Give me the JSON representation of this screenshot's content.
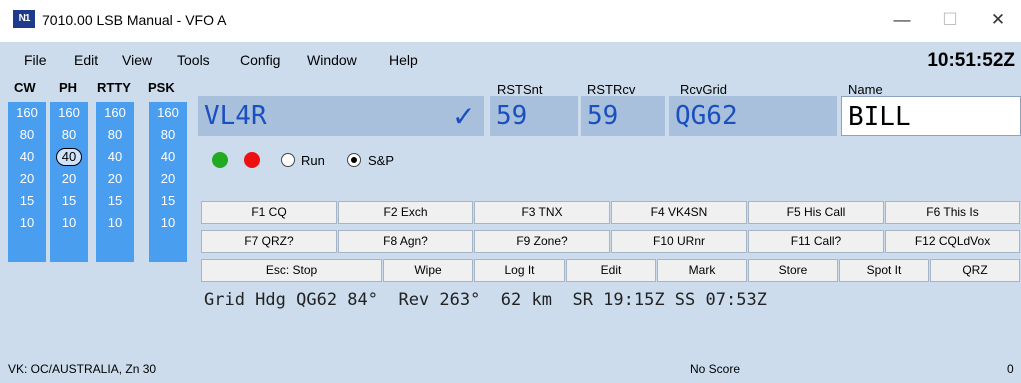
{
  "window": {
    "icon_text": "N1",
    "title": "7010.00 LSB Manual - VFO A",
    "minimize": "—",
    "maximize": "☐",
    "close": "✕"
  },
  "menu": [
    "File",
    "Edit",
    "View",
    "Tools",
    "Config",
    "Window",
    "Help"
  ],
  "clock": "10:51:52Z",
  "band_columns": [
    {
      "mode": "CW",
      "bands": [
        "160",
        "80",
        "40",
        "20",
        "15",
        "10"
      ]
    },
    {
      "mode": "PH",
      "bands": [
        "160",
        "80",
        "40",
        "20",
        "15",
        "10"
      ],
      "selected": "40"
    },
    {
      "mode": "RTTY",
      "bands": [
        "160",
        "80",
        "40",
        "20",
        "15",
        "10"
      ]
    },
    {
      "mode": "PSK",
      "bands": [
        "160",
        "80",
        "40",
        "20",
        "15",
        "10"
      ]
    }
  ],
  "entry": {
    "call": "VL4R",
    "check": "✓",
    "rst_sent_label": "RSTSnt",
    "rst_sent": "59",
    "rst_rcvd_label": "RSTRcv",
    "rst_rcvd": "59",
    "grid_label": "RcvGrid",
    "grid": "QG62",
    "name_label": "Name",
    "name": "BILL"
  },
  "mode_radio": {
    "run": "Run",
    "sp": "S&P",
    "selected": "S&P"
  },
  "fkeys": {
    "row1": [
      "F1 CQ",
      "F2 Exch",
      "F3 TNX",
      "F4 VK4SN",
      "F5 His Call",
      "F6 This Is"
    ],
    "row2": [
      "F7 QRZ?",
      "F8 Agn?",
      "F9 Zone?",
      "F10 URnr",
      "F11 Call?",
      "F12 CQLdVox"
    ],
    "row3": [
      "Esc: Stop",
      "Wipe",
      "Log It",
      "Edit",
      "Mark",
      "Store",
      "Spot It",
      "QRZ"
    ]
  },
  "grid_info": "Grid Hdg QG62 84°  Rev 263°  62 km  SR 19:15Z SS 07:53Z",
  "status": {
    "left": "VK: OC/AUSTRALIA, Zn 30",
    "center": "No Score",
    "right": "0"
  }
}
